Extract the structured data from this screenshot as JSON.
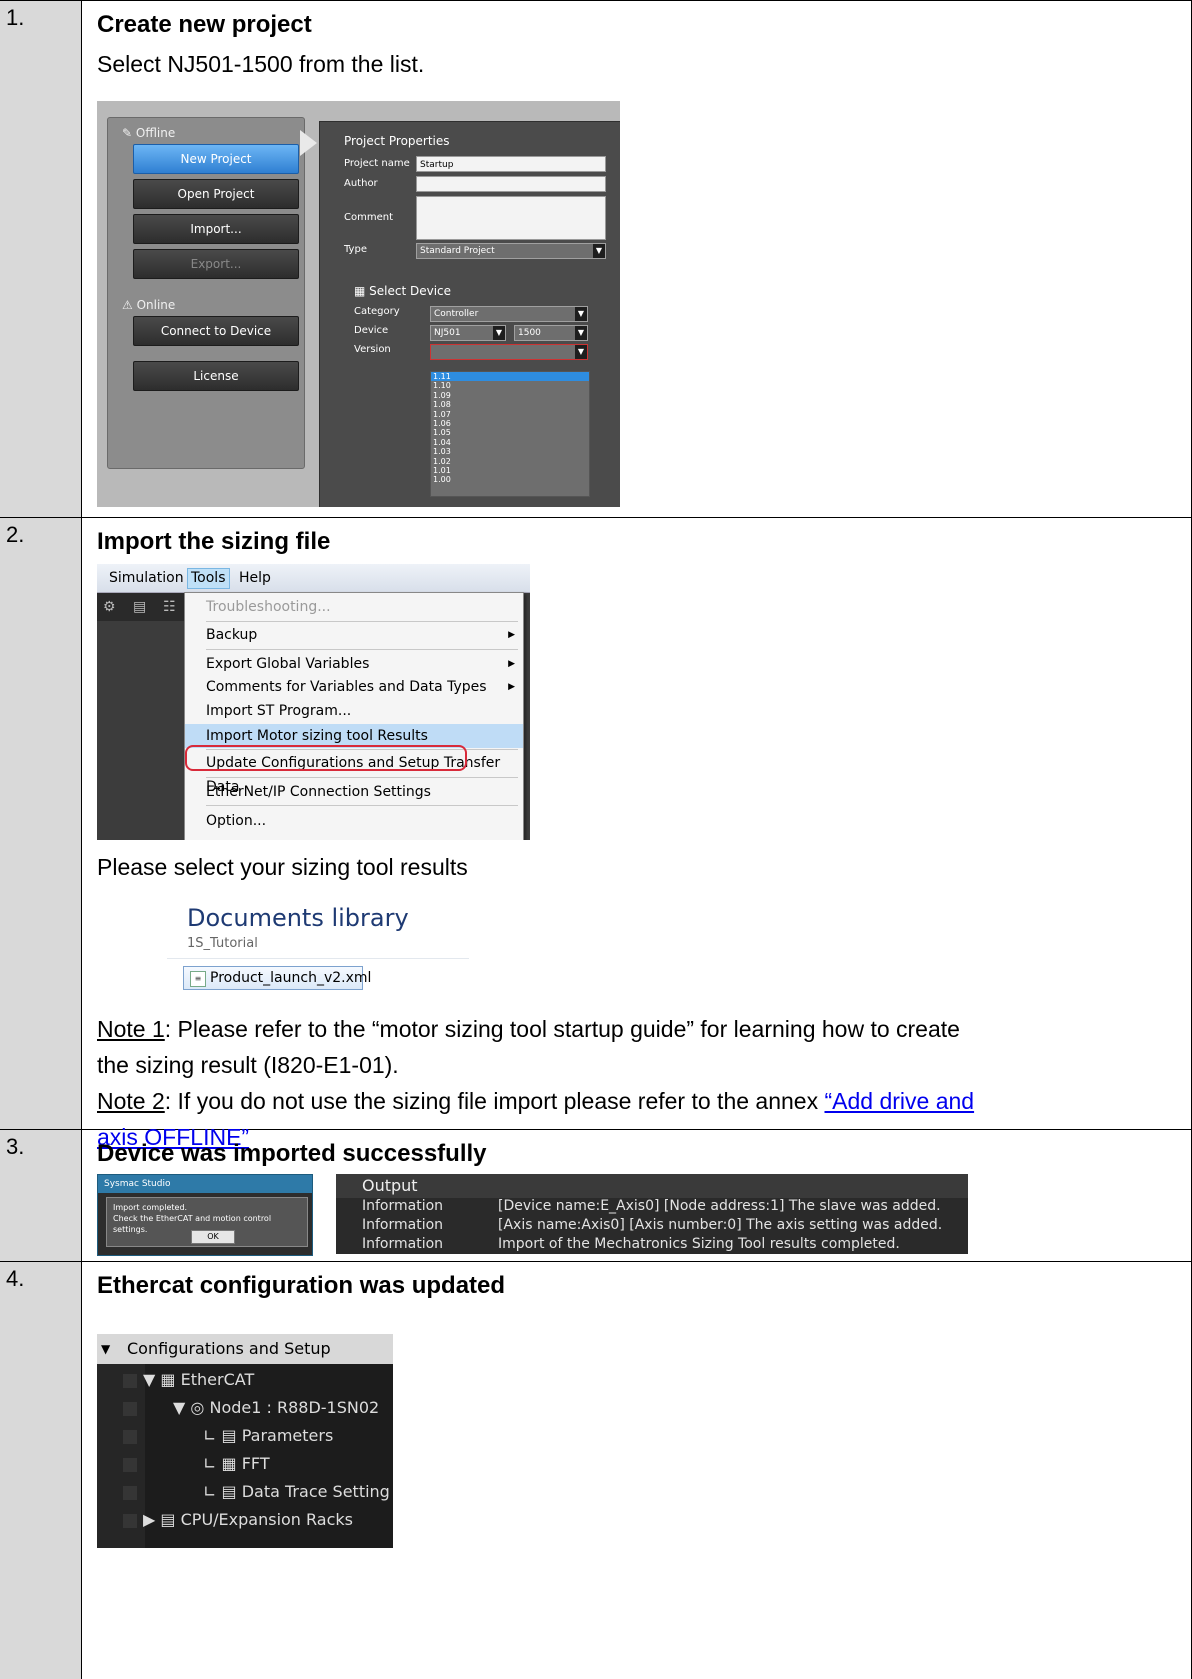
{
  "steps": [
    {
      "number": "1.",
      "title": "Create new project",
      "text": "Select NJ501-1500 from the list."
    },
    {
      "number": "2.",
      "title": "Import the sizing file",
      "select_text": "Please select your sizing tool results",
      "note1_label": "Note 1",
      "note1_text": ": Please refer to the “motor sizing tool startup guide” for learning how to create",
      "note1_text2": "the sizing result (I820-E1-01).",
      "note2_label": "Note 2",
      "note2_text": ": If you do not use the sizing file import please refer to the annex ",
      "note2_link1": "“Add drive and",
      "note2_link2": "axis OFFLINE”"
    },
    {
      "number": "3.",
      "title": "Device was imported successfully"
    },
    {
      "number": "4.",
      "title": "Ethercat configuration was updated"
    }
  ],
  "project_dialog": {
    "offline_label": "Offline",
    "online_label": "Online",
    "buttons": [
      "New Project",
      "Open Project",
      "Import...",
      "Export...",
      "Connect to Device",
      "License"
    ],
    "properties_title": "Project Properties",
    "project_name_label": "Project name",
    "project_name_value": "Startup",
    "author_label": "Author",
    "comment_label": "Comment",
    "type_label": "Type",
    "type_value": "Standard Project",
    "select_device_title": "Select Device",
    "category_label": "Category",
    "category_value": "Controller",
    "device_label": "Device",
    "device_value": "NJ501",
    "device_suffix": "1500",
    "version_label": "Version",
    "versions": [
      "1.11",
      "1.10",
      "1.09",
      "1.08",
      "1.07",
      "1.06",
      "1.05",
      "1.04",
      "1.03",
      "1.02",
      "1.01",
      "1.00"
    ]
  },
  "tools_menu": {
    "menubar": [
      "Simulation",
      "Tools",
      "Help"
    ],
    "items": [
      "Troubleshooting...",
      "Backup",
      "Export Global Variables",
      "Comments for Variables and Data Types",
      "Import ST Program...",
      "Import Motor sizing tool Results",
      "Update Configurations and Setup Transfer Data",
      "EtherNet/IP Connection Settings",
      "Option..."
    ]
  },
  "file_select": {
    "library_title": "Documents library",
    "folder": "1S_Tutorial",
    "file_name": "Product_launch_v2.xml"
  },
  "import_message": {
    "title": "Sysmac Studio",
    "line1": "Import completed.",
    "line2": "Check the EtherCAT and motion control settings.",
    "ok_label": "OK"
  },
  "output_panel": {
    "title": "Output",
    "rows": [
      {
        "type": "Information",
        "message": "[Device name:E_Axis0] [Node address:1] The slave was added."
      },
      {
        "type": "Information",
        "message": "[Axis name:Axis0] [Axis number:0] The axis setting was added."
      },
      {
        "type": "Information",
        "message": "Import of the Mechatronics Sizing Tool results completed."
      }
    ]
  },
  "config_tree": {
    "header": "Configurations and Setup",
    "items": [
      "EtherCAT",
      "Node1 : R88D-1SN02",
      "Parameters",
      "FFT",
      "Data Trace Setting",
      "CPU/Expansion Racks"
    ]
  }
}
